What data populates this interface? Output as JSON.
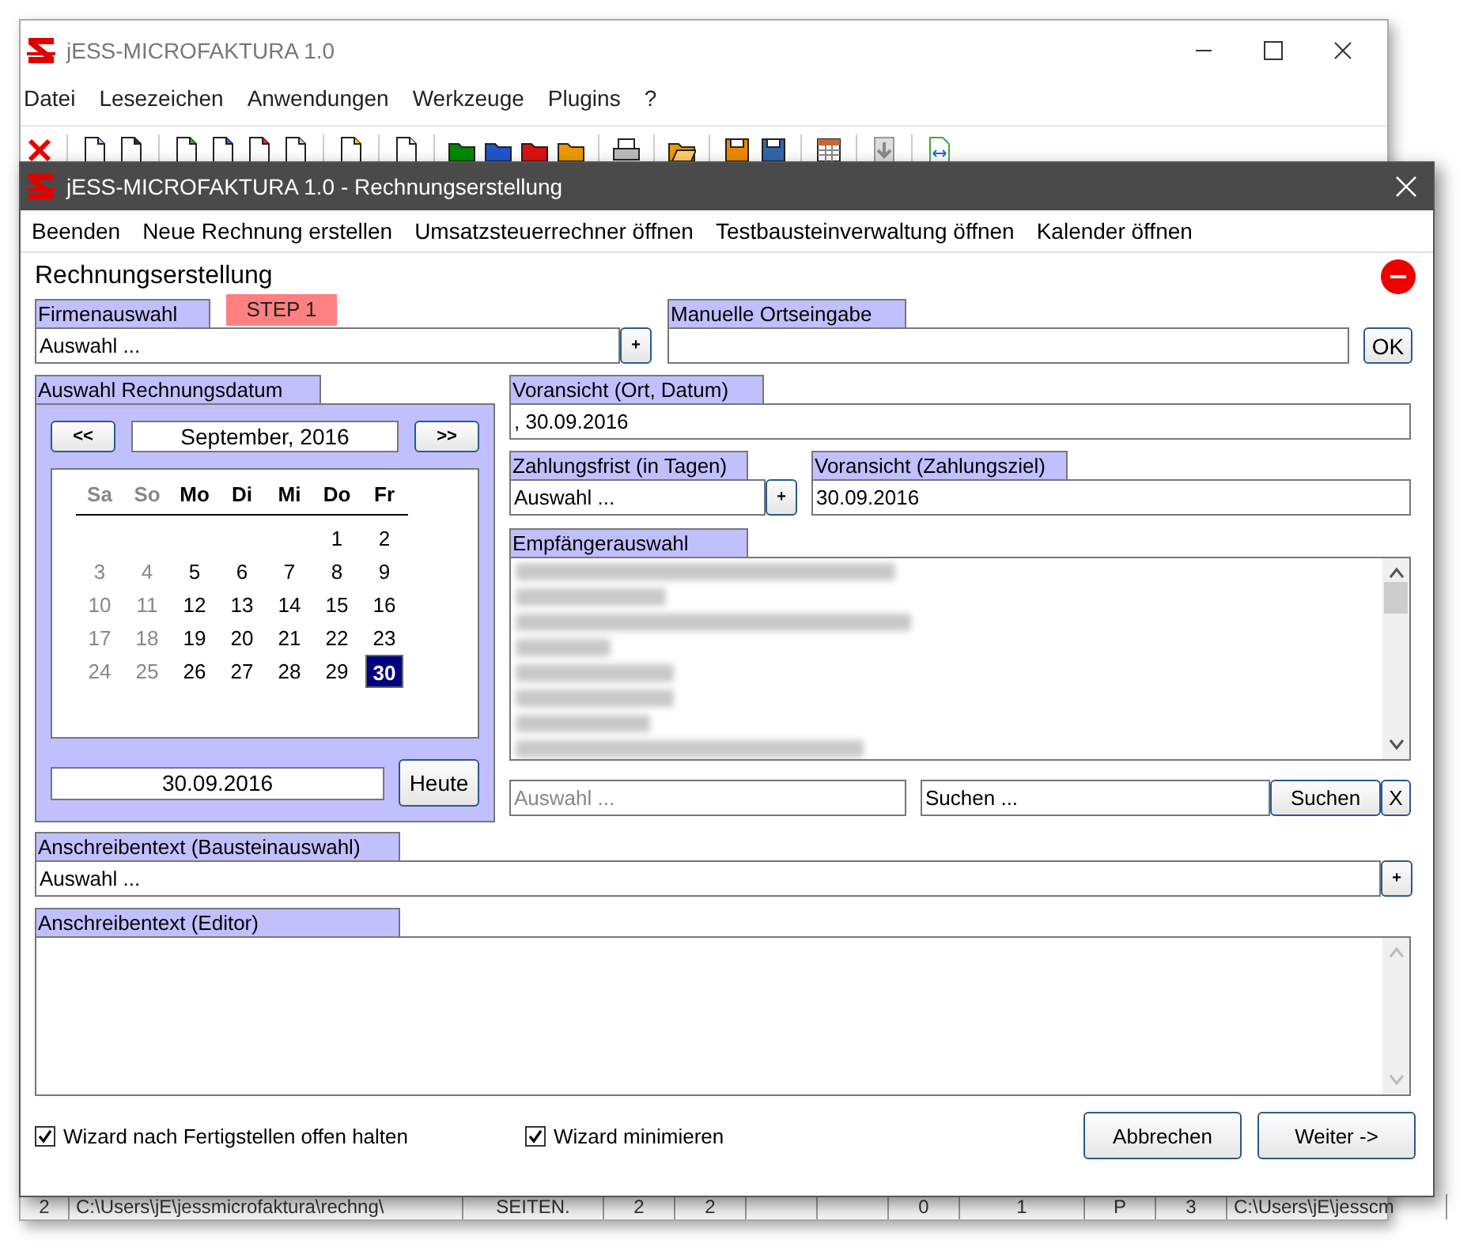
{
  "main_window": {
    "title": "jESS-MICROFAKTURA 1.0",
    "menu": [
      "Datei",
      "Lesezeichen",
      "Anwendungen",
      "Werkzeuge",
      "Plugins",
      "?"
    ],
    "table_row": [
      "2",
      "C:\\Users\\jE\\jessmicrofaktura\\rechng\\",
      "SEITEN.",
      "2",
      "2",
      "0",
      "1",
      "P",
      "3",
      "C:\\Users\\jE\\jesscm"
    ]
  },
  "dialog": {
    "title": "jESS-MICROFAKTURA 1.0 - Rechnungserstellung",
    "menu": [
      "Beenden",
      "Neue Rechnung erstellen",
      "Umsatzsteuerrechner öffnen",
      "Testbausteinverwaltung öffnen",
      "Kalender öffnen"
    ],
    "heading": "Rechnungserstellung",
    "step": "STEP 1",
    "company": {
      "label": "Firmenauswahl",
      "value": "Auswahl ...",
      "add": "+"
    },
    "place": {
      "label": "Manuelle Ortseingabe",
      "ok": "OK"
    },
    "calendar": {
      "label": "Auswahl Rechnungsdatum",
      "prev": "<<",
      "next": ">>",
      "month": "September, 2016",
      "weekdays": [
        {
          "name": "Sa",
          "weekend": true
        },
        {
          "name": "So",
          "weekend": true
        },
        {
          "name": "Mo",
          "weekend": false
        },
        {
          "name": "Di",
          "weekend": false
        },
        {
          "name": "Mi",
          "weekend": false
        },
        {
          "name": "Do",
          "weekend": false
        },
        {
          "name": "Fr",
          "weekend": false
        }
      ],
      "weeks": [
        [
          {
            "day": "1",
            "weekend": false,
            "selected": false
          },
          {
            "day": "2",
            "weekend": false,
            "selected": false
          }
        ],
        [
          {
            "day": "3",
            "weekend": true,
            "selected": false
          },
          {
            "day": "4",
            "weekend": true,
            "selected": false
          },
          {
            "day": "5",
            "weekend": false,
            "selected": false
          },
          {
            "day": "6",
            "weekend": false,
            "selected": false
          },
          {
            "day": "7",
            "weekend": false,
            "selected": false
          },
          {
            "day": "8",
            "weekend": false,
            "selected": false
          },
          {
            "day": "9",
            "weekend": false,
            "selected": false
          }
        ],
        [
          {
            "day": "10",
            "weekend": true,
            "selected": false
          },
          {
            "day": "11",
            "weekend": true,
            "selected": false
          },
          {
            "day": "12",
            "weekend": false,
            "selected": false
          },
          {
            "day": "13",
            "weekend": false,
            "selected": false
          },
          {
            "day": "14",
            "weekend": false,
            "selected": false
          },
          {
            "day": "15",
            "weekend": false,
            "selected": false
          },
          {
            "day": "16",
            "weekend": false,
            "selected": false
          }
        ],
        [
          {
            "day": "17",
            "weekend": true,
            "selected": false
          },
          {
            "day": "18",
            "weekend": true,
            "selected": false
          },
          {
            "day": "19",
            "weekend": false,
            "selected": false
          },
          {
            "day": "20",
            "weekend": false,
            "selected": false
          },
          {
            "day": "21",
            "weekend": false,
            "selected": false
          },
          {
            "day": "22",
            "weekend": false,
            "selected": false
          },
          {
            "day": "23",
            "weekend": false,
            "selected": false
          }
        ],
        [
          {
            "day": "24",
            "weekend": true,
            "selected": false
          },
          {
            "day": "25",
            "weekend": true,
            "selected": false
          },
          {
            "day": "26",
            "weekend": false,
            "selected": false
          },
          {
            "day": "27",
            "weekend": false,
            "selected": false
          },
          {
            "day": "28",
            "weekend": false,
            "selected": false
          },
          {
            "day": "29",
            "weekend": false,
            "selected": false
          },
          {
            "day": "30",
            "weekend": false,
            "selected": true
          }
        ]
      ],
      "date": "30.09.2016",
      "today": "Heute"
    },
    "preview_place": {
      "label": "Voransicht (Ort, Datum)",
      "value": ", 30.09.2016"
    },
    "payment_term": {
      "label": "Zahlungsfrist (in Tagen)",
      "value": "Auswahl ...",
      "add": "+"
    },
    "preview_due": {
      "label": "Voransicht (Zahlungsziel)",
      "value": "30.09.2016"
    },
    "recipients": {
      "label": "Empfängerauswahl",
      "items": [
        {
          "kind": "redacted"
        },
        {
          "kind": "redacted"
        },
        {
          "kind": "redacted"
        },
        {
          "kind": "redacted"
        },
        {
          "kind": "redacted"
        },
        {
          "kind": "redacted"
        },
        {
          "kind": "redacted"
        },
        {
          "kind": "redacted"
        }
      ],
      "selection_placeholder": "Auswahl ...",
      "search_value": "Suchen ...",
      "search_button": "Suchen",
      "clear": "X"
    },
    "letter_block": {
      "label": "Anschreibentext (Bausteinauswahl)",
      "value": "Auswahl ...",
      "add": "+"
    },
    "letter_editor": {
      "label": "Anschreibentext (Editor)"
    },
    "options": [
      {
        "label": "Wizard nach Fertigstellen offen halten",
        "checked": true
      },
      {
        "label": "Wizard minimieren",
        "checked": true
      }
    ],
    "buttons": [
      "Abbrechen",
      "Weiter ->"
    ]
  }
}
